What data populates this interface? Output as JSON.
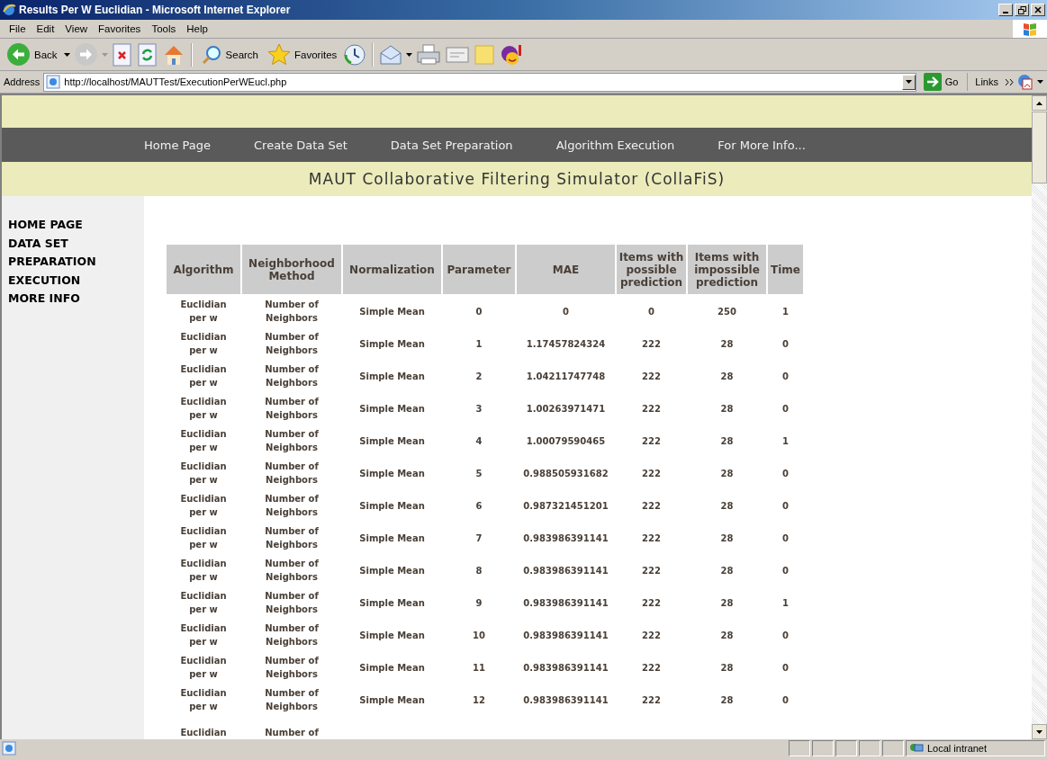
{
  "window": {
    "title": "Results Per W Euclidian - Microsoft Internet Explorer"
  },
  "menu": [
    "File",
    "Edit",
    "View",
    "Favorites",
    "Tools",
    "Help"
  ],
  "toolbar": {
    "back": "Back",
    "search": "Search",
    "favorites": "Favorites"
  },
  "address_bar": {
    "label": "Address",
    "url": "http://localhost/MAUTTest/ExecutionPerWEucl.php",
    "go": "Go",
    "links": "Links"
  },
  "site_nav": [
    "Home Page",
    "Create Data Set",
    "Data Set Preparation",
    "Algorithm Execution",
    "For More Info..."
  ],
  "site_title": "MAUT Collaborative Filtering Simulator (CollaFiS)",
  "sidebar": {
    "items": [
      "HOME PAGE",
      "DATA SET PREPARATION",
      "EXECUTION",
      "MORE INFO"
    ]
  },
  "table": {
    "columns": [
      "Algorithm",
      "Neighborhood Method",
      "Normalization",
      "Parameter",
      "MAE",
      "Items with possible prediction",
      "Items with impossible prediction",
      "Time"
    ],
    "rows": [
      [
        "Euclidian per w",
        "Number of Neighbors",
        "Simple Mean",
        "0",
        "0",
        "0",
        "250",
        "1"
      ],
      [
        "Euclidian per w",
        "Number of Neighbors",
        "Simple Mean",
        "1",
        "1.17457824324",
        "222",
        "28",
        "0"
      ],
      [
        "Euclidian per w",
        "Number of Neighbors",
        "Simple Mean",
        "2",
        "1.04211747748",
        "222",
        "28",
        "0"
      ],
      [
        "Euclidian per w",
        "Number of Neighbors",
        "Simple Mean",
        "3",
        "1.00263971471",
        "222",
        "28",
        "0"
      ],
      [
        "Euclidian per w",
        "Number of Neighbors",
        "Simple Mean",
        "4",
        "1.00079590465",
        "222",
        "28",
        "1"
      ],
      [
        "Euclidian per w",
        "Number of Neighbors",
        "Simple Mean",
        "5",
        "0.988505931682",
        "222",
        "28",
        "0"
      ],
      [
        "Euclidian per w",
        "Number of Neighbors",
        "Simple Mean",
        "6",
        "0.987321451201",
        "222",
        "28",
        "0"
      ],
      [
        "Euclidian per w",
        "Number of Neighbors",
        "Simple Mean",
        "7",
        "0.983986391141",
        "222",
        "28",
        "0"
      ],
      [
        "Euclidian per w",
        "Number of Neighbors",
        "Simple Mean",
        "8",
        "0.983986391141",
        "222",
        "28",
        "0"
      ],
      [
        "Euclidian per w",
        "Number of Neighbors",
        "Simple Mean",
        "9",
        "0.983986391141",
        "222",
        "28",
        "1"
      ],
      [
        "Euclidian per w",
        "Number of Neighbors",
        "Simple Mean",
        "10",
        "0.983986391141",
        "222",
        "28",
        "0"
      ],
      [
        "Euclidian per w",
        "Number of Neighbors",
        "Simple Mean",
        "11",
        "0.983986391141",
        "222",
        "28",
        "0"
      ],
      [
        "Euclidian per w",
        "Number of Neighbors",
        "Simple Mean",
        "12",
        "0.983986391141",
        "222",
        "28",
        "0"
      ],
      [
        "Euclidian",
        "Number of"
      ]
    ]
  },
  "status_bar": {
    "zone": "Local intranet"
  }
}
